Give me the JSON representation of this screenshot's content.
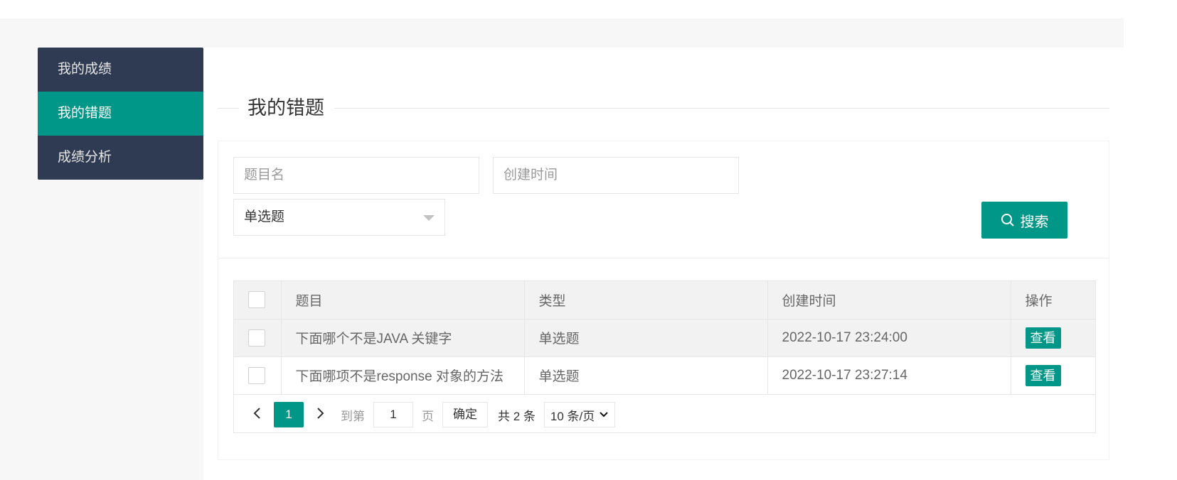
{
  "sidebar": {
    "items": [
      {
        "label": "我的成绩"
      },
      {
        "label": "我的错题",
        "active": true
      },
      {
        "label": "成绩分析"
      }
    ]
  },
  "section": {
    "title": "我的错题"
  },
  "filters": {
    "name_placeholder": "题目名",
    "time_placeholder": "创建时间",
    "type_selected": "单选题",
    "search_label": "搜索"
  },
  "table": {
    "columns": [
      "题目",
      "类型",
      "创建时间",
      "操作"
    ],
    "rows": [
      {
        "title": "下面哪个不是JAVA 关键字",
        "type": "单选题",
        "created": "2022-10-17 23:24:00",
        "action": "查看"
      },
      {
        "title": "下面哪项不是response 对象的方法",
        "type": "单选题",
        "created": "2022-10-17 23:27:14",
        "action": "查看"
      }
    ]
  },
  "pagination": {
    "current": "1",
    "goto_prefix": "到第",
    "goto_value": "1",
    "goto_suffix": "页",
    "confirm": "确定",
    "total": "共 2 条",
    "page_size": "10 条/页"
  },
  "colors": {
    "accent": "#009688",
    "sidebar": "#2f3b52"
  }
}
